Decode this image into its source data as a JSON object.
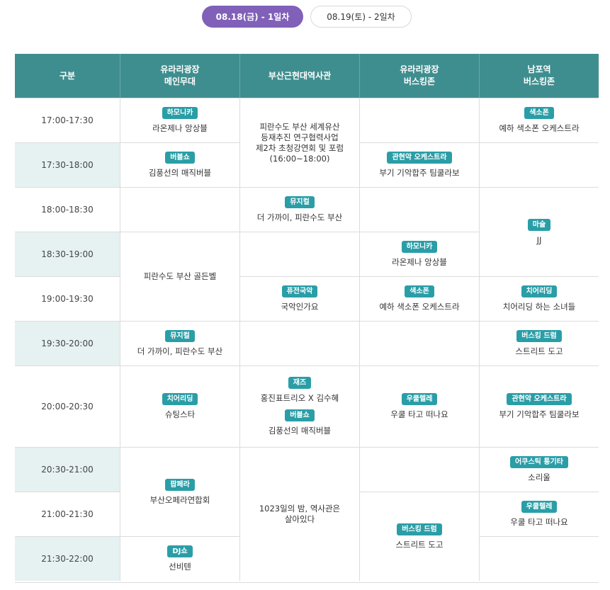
{
  "tabs": [
    {
      "label": "08.18(금) - 1일차"
    },
    {
      "label": "08.19(토) - 2일차"
    }
  ],
  "header": {
    "col0": "구분",
    "col1_line1": "유라리광장",
    "col1_line2": "메인무대",
    "col2": "부산근현대역사관",
    "col3_line1": "유라리광장",
    "col3_line2": "버스킹존",
    "col4_line1": "남포역",
    "col4_line2": "버스킹존"
  },
  "times": [
    "17:00-17:30",
    "17:30-18:00",
    "18:00-18:30",
    "18:30-19:00",
    "19:00-19:30",
    "19:30-20:00",
    "20:00-20:30",
    "20:30-21:00",
    "21:00-21:30",
    "21:30-22:00"
  ],
  "events": {
    "c1_1": {
      "badge": "하모니카",
      "text": "라온제나 앙상블"
    },
    "c1_2": {
      "badge": "버블쇼",
      "text": "김풍선의 매직버블"
    },
    "c1_5": {
      "text": "피란수도 부산 골든벨"
    },
    "c1_6": {
      "badge": "뮤지컬",
      "text": "더 가까이, 피란수도 부산"
    },
    "c1_7": {
      "badge": "치어리딩",
      "text": "슈팅스타"
    },
    "c1_8": {
      "badge": "팝페라",
      "text": "부산오페라연합회"
    },
    "c1_10": {
      "badge": "DJ쇼",
      "text": "선비텐"
    },
    "c2_1": {
      "line1": "피란수도 부산 세계유산",
      "line2": "등재추진 연구협력사업",
      "line3": "제2차 초청강연회 및 포럼",
      "line4": "(16:00~18:00)"
    },
    "c2_3": {
      "badge": "뮤지컬",
      "text": "더 가까이, 피란수도 부산"
    },
    "c2_5": {
      "badge": "퓨전국악",
      "text": "국악인가요"
    },
    "c2_7a": {
      "badge": "재즈",
      "text": "홍진표트리오 X 김수혜"
    },
    "c2_7b": {
      "badge": "버블쇼",
      "text": "김풍선의 매직버블"
    },
    "c2_8": {
      "line1": "1023일의 밤, 역사관은",
      "line2": "살아있다"
    },
    "c3_2": {
      "badge": "관현악 오케스트라",
      "text": "부기 기악합주 팀쿨라보"
    },
    "c3_4": {
      "badge": "하모니카",
      "text": "라온제나 앙상블"
    },
    "c3_5": {
      "badge": "색소폰",
      "text": "예하 색소폰 오케스트라"
    },
    "c3_7": {
      "badge": "우쿨렐레",
      "text": "우쿨 타고 떠나요"
    },
    "c3_9": {
      "badge": "버스킹 드럼",
      "text": "스트리트 도고"
    },
    "c4_1": {
      "badge": "색소폰",
      "text": "예하 색소폰 오케스트라"
    },
    "c4_3": {
      "badge": "마술",
      "text": "JJ"
    },
    "c4_5": {
      "badge": "치어리딩",
      "text": "치어리딩 하는 소녀들"
    },
    "c4_6": {
      "badge": "버스킹 드럼",
      "text": "스트리트 도고"
    },
    "c4_7": {
      "badge": "관현악 오케스트라",
      "text": "부기 기악합주 팀쿨라보"
    },
    "c4_8": {
      "badge": "어쿠스틱 통기타",
      "text": "소리울"
    },
    "c4_9": {
      "badge": "우쿨렐레",
      "text": "우쿨 타고 떠나요"
    }
  }
}
